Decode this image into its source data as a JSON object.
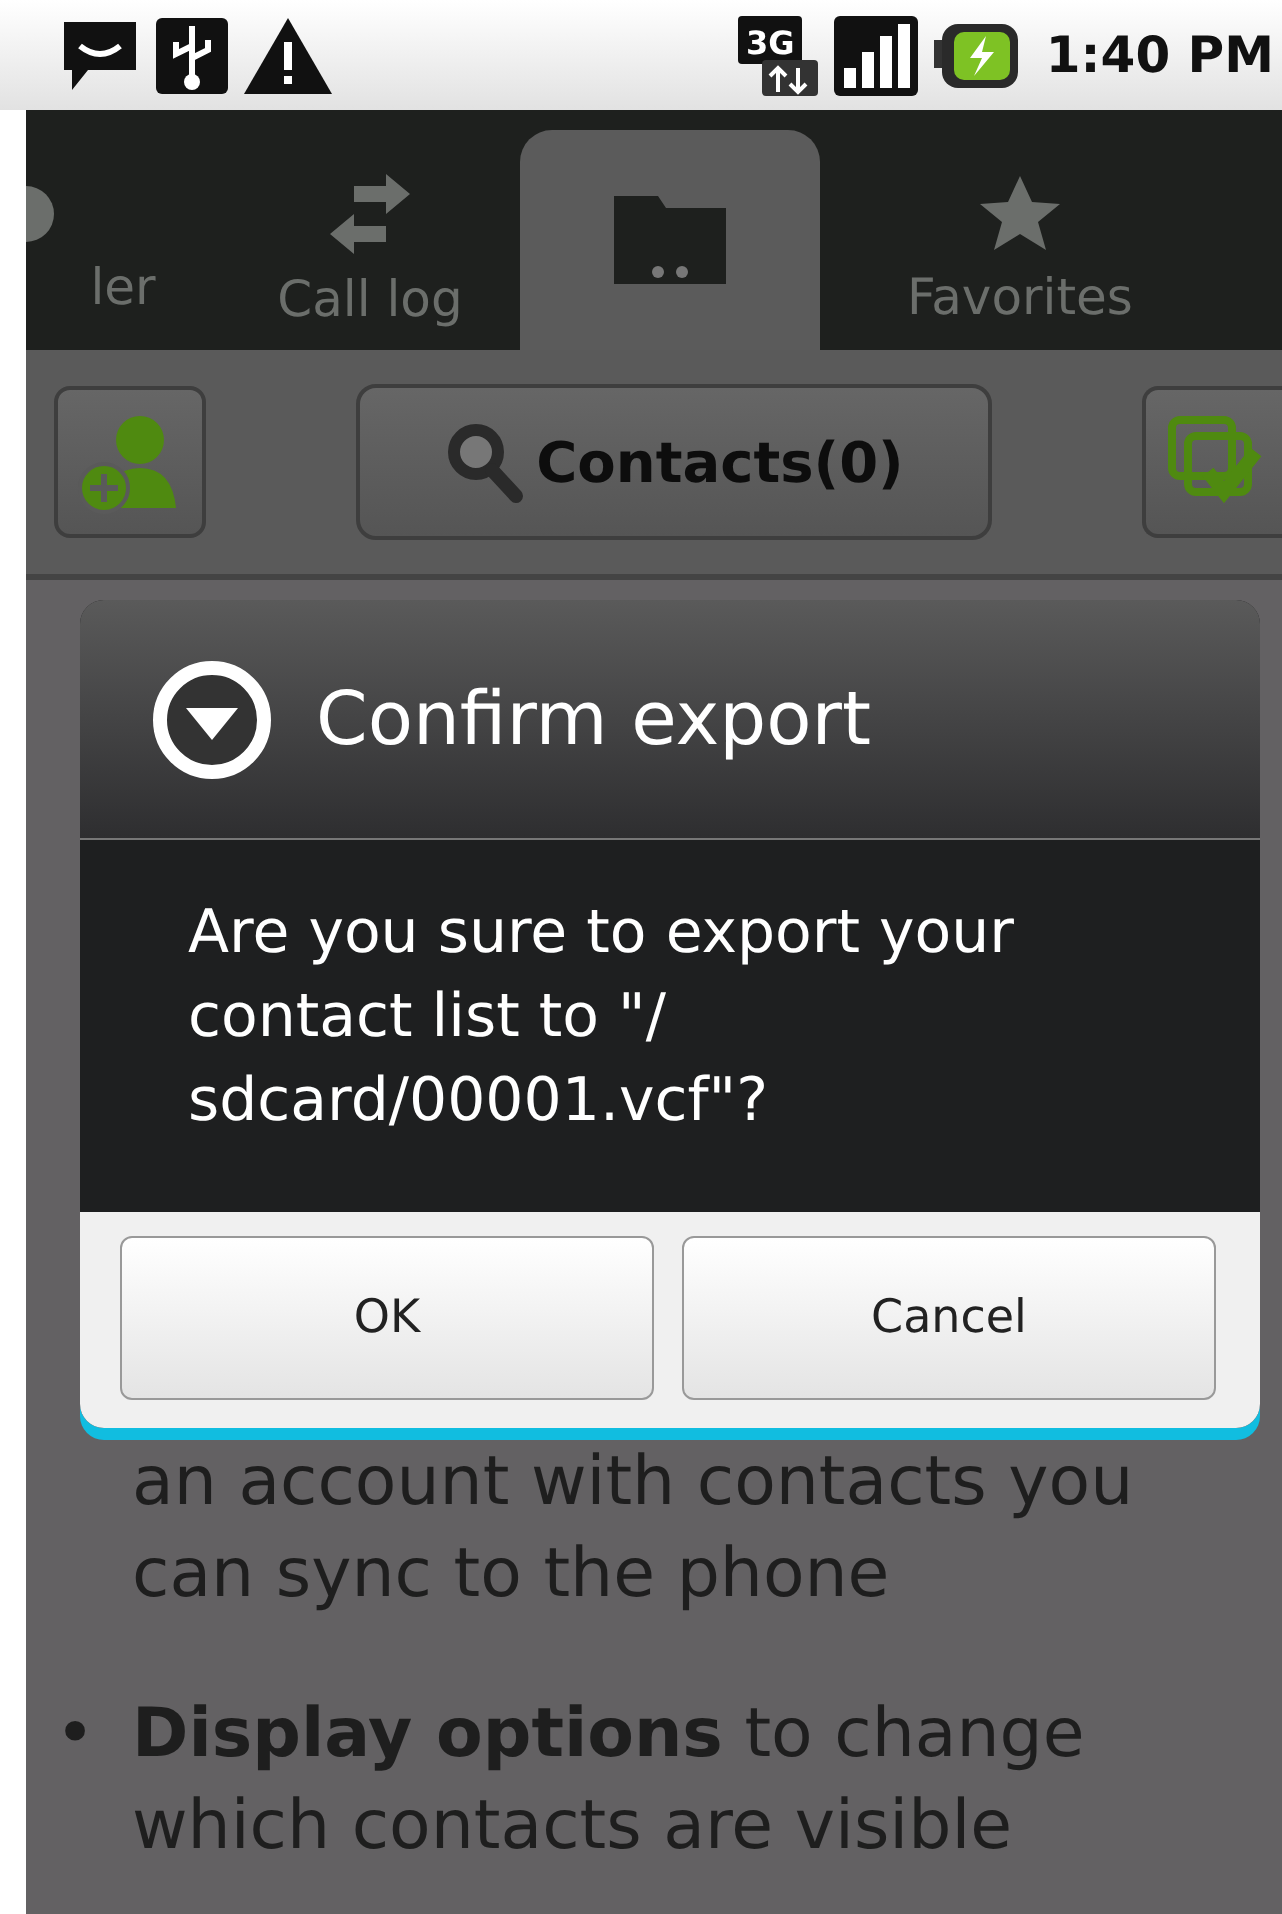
{
  "status_bar": {
    "time": "1:40 PM",
    "network": "3G"
  },
  "tabs": [
    {
      "label": "ler",
      "kind": "dialer",
      "selected": false
    },
    {
      "label": "Call log",
      "kind": "calllog",
      "selected": false
    },
    {
      "kind": "contacts",
      "selected": true
    },
    {
      "label": "Favorites",
      "kind": "favorites",
      "selected": false
    }
  ],
  "toolbar": {
    "title": "Contacts(0)"
  },
  "content": [
    {
      "kind": "continuation",
      "text": "an account with contacts you can sync to the phone"
    },
    {
      "kind": "bullet",
      "marker": "•",
      "text": "**Display options** to change which contacts are visible"
    }
  ],
  "dialog": {
    "title": "Confirm export",
    "message": "Are you sure to export your contact list to \"/ sdcard/00001.vcf\"?",
    "buttons": [
      "OK",
      "Cancel"
    ]
  }
}
